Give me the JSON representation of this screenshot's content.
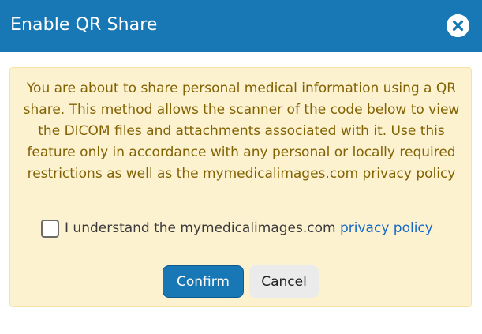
{
  "dialog": {
    "title": "Enable QR Share",
    "close_icon": "close-circle-icon"
  },
  "notice": {
    "warning_text": "You are about to share personal medical information using a QR share. This method allows the scanner of the code below to view the DICOM files and attachments associated with it. Use this feature only in accordance with any personal or locally required restrictions as well as the mymedicalimages.com privacy policy",
    "consent_checked": false,
    "consent_label": "I understand the mymedicalimages.com ",
    "consent_link": "privacy policy"
  },
  "buttons": {
    "confirm_label": "Confirm",
    "cancel_label": "Cancel"
  },
  "colors": {
    "header": "#1878b5",
    "notice_bg": "#fdf2d0",
    "warning_text": "#826304",
    "link": "#1468c6"
  }
}
